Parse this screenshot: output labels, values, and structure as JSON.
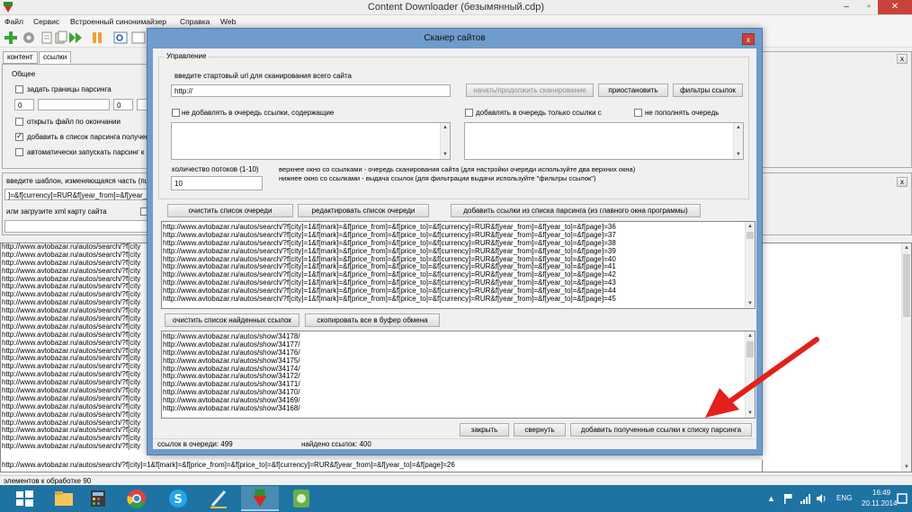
{
  "window": {
    "title": "Content Downloader (безымянный.cdp)",
    "min": "–",
    "max": "▫",
    "close": "✕"
  },
  "menu": [
    "Файл",
    "Сервис",
    "Встроенный синонимайзер",
    "Справка",
    "Web"
  ],
  "left": {
    "tabs": [
      "контент",
      "ссылки"
    ],
    "group_title": "Общее",
    "opt_bounds": "задать границы парсинга",
    "field1": "0",
    "field2": "0",
    "opt_open": "открыть файл по окончании",
    "opt_add": "добавить в список парсинга получен",
    "opt_auto": "автоматически запускать парсинг к",
    "template_label": "введите шаблон, изменяющаяся часть (пц",
    "template_value": "]=&f[currency]=RUR&f[year_from]=&f[year_",
    "xml_label": "или загрузите xml карту сайта",
    "side_x": "x",
    "links": [
      "http://www.avtobazar.ru/autos/search/?f[city",
      "http://www.avtobazar.ru/autos/search/?f[city",
      "http://www.avtobazar.ru/autos/search/?f[city",
      "http://www.avtobazar.ru/autos/search/?f[city",
      "http://www.avtobazar.ru/autos/search/?f[city",
      "http://www.avtobazar.ru/autos/search/?f[city",
      "http://www.avtobazar.ru/autos/search/?f[city",
      "http://www.avtobazar.ru/autos/search/?f[city",
      "http://www.avtobazar.ru/autos/search/?f[city",
      "http://www.avtobazar.ru/autos/search/?f[city",
      "http://www.avtobazar.ru/autos/search/?f[city",
      "http://www.avtobazar.ru/autos/search/?f[city",
      "http://www.avtobazar.ru/autos/search/?f[city",
      "http://www.avtobazar.ru/autos/search/?f[city",
      "http://www.avtobazar.ru/autos/search/?f[city",
      "http://www.avtobazar.ru/autos/search/?f[city",
      "http://www.avtobazar.ru/autos/search/?f[city",
      "http://www.avtobazar.ru/autos/search/?f[city",
      "http://www.avtobazar.ru/autos/search/?f[city",
      "http://www.avtobazar.ru/autos/search/?f[city",
      "http://www.avtobazar.ru/autos/search/?f[city",
      "http://www.avtobazar.ru/autos/search/?f[city",
      "http://www.avtobazar.ru/autos/search/?f[city",
      "http://www.avtobazar.ru/autos/search/?f[city",
      "http://www.avtobazar.ru/autos/search/?f[city",
      "http://www.avtobazar.ru/autos/search/?f[city"
    ],
    "bottom_line": "http://www.avtobazar.ru/autos/search/?f[city]=1&f[mark]=&f[price_from]=&f[price_to]=&f[currency]=RUR&f[year_from]=&f[year_to]=&f[page]=26",
    "status": "элементов к обработке 90"
  },
  "dialog": {
    "title": "Сканер сайтов",
    "close": "x",
    "group": "Управление",
    "start_label": "введите стартовый url для сканирования всего сайта",
    "start_value": "http://",
    "btn_start": "начать/продолжить сканирование",
    "btn_pause": "приостановить",
    "btn_filters": "фильтры ссылок",
    "cb_exclude": "не добавлять в очередь ссылки, содержащие",
    "cb_only": "добавлять в очередь только ссылки с",
    "cb_nofill": "не пополнять очередь",
    "threads_label": "количество потоков (1-10)",
    "threads_value": "10",
    "hint1": "верхнее окно со ссылками - очередь сканирования сайта (для настройки очереди используйте два верхних окна)",
    "hint2": "нижнее окно со ссылками - выдача ссылок (для фильтрации выдачи используйте \"фильтры ссылок\")",
    "btn_clear_queue": "очистить список очереди",
    "btn_edit_queue": "редактировать список очереди",
    "btn_add_from_list": "добавить ссылки из списка парсинга (из главного окна программы)",
    "queue": [
      "http://www.avtobazar.ru/autos/search/?f[city]=1&f[mark]=&f[price_from]=&f[price_to]=&f[currency]=RUR&f[year_from]=&f[year_to]=&f[page]=36",
      "http://www.avtobazar.ru/autos/search/?f[city]=1&f[mark]=&f[price_from]=&f[price_to]=&f[currency]=RUR&f[year_from]=&f[year_to]=&f[page]=37",
      "http://www.avtobazar.ru/autos/search/?f[city]=1&f[mark]=&f[price_from]=&f[price_to]=&f[currency]=RUR&f[year_from]=&f[year_to]=&f[page]=38",
      "http://www.avtobazar.ru/autos/search/?f[city]=1&f[mark]=&f[price_from]=&f[price_to]=&f[currency]=RUR&f[year_from]=&f[year_to]=&f[page]=39",
      "http://www.avtobazar.ru/autos/search/?f[city]=1&f[mark]=&f[price_from]=&f[price_to]=&f[currency]=RUR&f[year_from]=&f[year_to]=&f[page]=40",
      "http://www.avtobazar.ru/autos/search/?f[city]=1&f[mark]=&f[price_from]=&f[price_to]=&f[currency]=RUR&f[year_from]=&f[year_to]=&f[page]=41",
      "http://www.avtobazar.ru/autos/search/?f[city]=1&f[mark]=&f[price_from]=&f[price_to]=&f[currency]=RUR&f[year_from]=&f[year_to]=&f[page]=42",
      "http://www.avtobazar.ru/autos/search/?f[city]=1&f[mark]=&f[price_from]=&f[price_to]=&f[currency]=RUR&f[year_from]=&f[year_to]=&f[page]=43",
      "http://www.avtobazar.ru/autos/search/?f[city]=1&f[mark]=&f[price_from]=&f[price_to]=&f[currency]=RUR&f[year_from]=&f[year_to]=&f[page]=44",
      "http://www.avtobazar.ru/autos/search/?f[city]=1&f[mark]=&f[price_from]=&f[price_to]=&f[currency]=RUR&f[year_from]=&f[year_to]=&f[page]=45"
    ],
    "btn_clear_found": "очистить список найденных ссылок",
    "btn_copy_all": "скопировать все в буфер обмена",
    "found": [
      "http://www.avtobazar.ru/autos/show/34178/",
      "http://www.avtobazar.ru/autos/show/34177/",
      "http://www.avtobazar.ru/autos/show/34176/",
      "http://www.avtobazar.ru/autos/show/34175/",
      "http://www.avtobazar.ru/autos/show/34174/",
      "http://www.avtobazar.ru/autos/show/34172/",
      "http://www.avtobazar.ru/autos/show/34171/",
      "http://www.avtobazar.ru/autos/show/34170/",
      "http://www.avtobazar.ru/autos/show/34169/",
      "http://www.avtobazar.ru/autos/show/34168/"
    ],
    "btn_close": "закрыть",
    "btn_minimize": "свернуть",
    "btn_add_links": "добавить полученные ссылки к списку парсинга",
    "status_queue": "ссылок в очереди: 499",
    "status_found": "найдено ссылок: 400"
  },
  "taskbar": {
    "lang": "ENG",
    "time": "16:49",
    "date": "20.11.2014"
  },
  "colors": {
    "dialog_frame": "#6f9ccc",
    "taskbar": "#1f73a3",
    "arrow": "#e3201b"
  }
}
